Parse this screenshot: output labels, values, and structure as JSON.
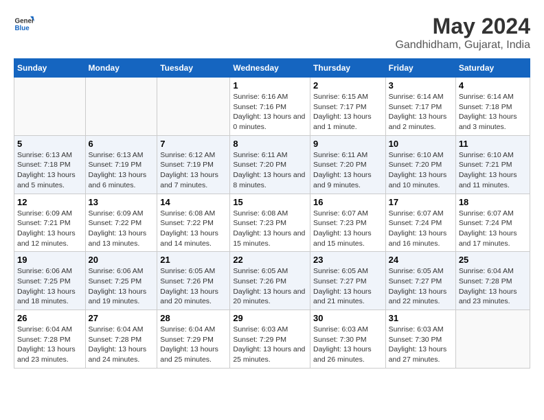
{
  "logo": {
    "line1": "General",
    "line2": "Blue"
  },
  "title": "May 2024",
  "subtitle": "Gandhidham, Gujarat, India",
  "weekdays": [
    "Sunday",
    "Monday",
    "Tuesday",
    "Wednesday",
    "Thursday",
    "Friday",
    "Saturday"
  ],
  "weeks": [
    [
      {
        "day": "",
        "sunrise": "",
        "sunset": "",
        "daylight": ""
      },
      {
        "day": "",
        "sunrise": "",
        "sunset": "",
        "daylight": ""
      },
      {
        "day": "",
        "sunrise": "",
        "sunset": "",
        "daylight": ""
      },
      {
        "day": "1",
        "sunrise": "Sunrise: 6:16 AM",
        "sunset": "Sunset: 7:16 PM",
        "daylight": "Daylight: 13 hours and 0 minutes."
      },
      {
        "day": "2",
        "sunrise": "Sunrise: 6:15 AM",
        "sunset": "Sunset: 7:17 PM",
        "daylight": "Daylight: 13 hours and 1 minute."
      },
      {
        "day": "3",
        "sunrise": "Sunrise: 6:14 AM",
        "sunset": "Sunset: 7:17 PM",
        "daylight": "Daylight: 13 hours and 2 minutes."
      },
      {
        "day": "4",
        "sunrise": "Sunrise: 6:14 AM",
        "sunset": "Sunset: 7:18 PM",
        "daylight": "Daylight: 13 hours and 3 minutes."
      }
    ],
    [
      {
        "day": "5",
        "sunrise": "Sunrise: 6:13 AM",
        "sunset": "Sunset: 7:18 PM",
        "daylight": "Daylight: 13 hours and 5 minutes."
      },
      {
        "day": "6",
        "sunrise": "Sunrise: 6:13 AM",
        "sunset": "Sunset: 7:19 PM",
        "daylight": "Daylight: 13 hours and 6 minutes."
      },
      {
        "day": "7",
        "sunrise": "Sunrise: 6:12 AM",
        "sunset": "Sunset: 7:19 PM",
        "daylight": "Daylight: 13 hours and 7 minutes."
      },
      {
        "day": "8",
        "sunrise": "Sunrise: 6:11 AM",
        "sunset": "Sunset: 7:20 PM",
        "daylight": "Daylight: 13 hours and 8 minutes."
      },
      {
        "day": "9",
        "sunrise": "Sunrise: 6:11 AM",
        "sunset": "Sunset: 7:20 PM",
        "daylight": "Daylight: 13 hours and 9 minutes."
      },
      {
        "day": "10",
        "sunrise": "Sunrise: 6:10 AM",
        "sunset": "Sunset: 7:20 PM",
        "daylight": "Daylight: 13 hours and 10 minutes."
      },
      {
        "day": "11",
        "sunrise": "Sunrise: 6:10 AM",
        "sunset": "Sunset: 7:21 PM",
        "daylight": "Daylight: 13 hours and 11 minutes."
      }
    ],
    [
      {
        "day": "12",
        "sunrise": "Sunrise: 6:09 AM",
        "sunset": "Sunset: 7:21 PM",
        "daylight": "Daylight: 13 hours and 12 minutes."
      },
      {
        "day": "13",
        "sunrise": "Sunrise: 6:09 AM",
        "sunset": "Sunset: 7:22 PM",
        "daylight": "Daylight: 13 hours and 13 minutes."
      },
      {
        "day": "14",
        "sunrise": "Sunrise: 6:08 AM",
        "sunset": "Sunset: 7:22 PM",
        "daylight": "Daylight: 13 hours and 14 minutes."
      },
      {
        "day": "15",
        "sunrise": "Sunrise: 6:08 AM",
        "sunset": "Sunset: 7:23 PM",
        "daylight": "Daylight: 13 hours and 15 minutes."
      },
      {
        "day": "16",
        "sunrise": "Sunrise: 6:07 AM",
        "sunset": "Sunset: 7:23 PM",
        "daylight": "Daylight: 13 hours and 15 minutes."
      },
      {
        "day": "17",
        "sunrise": "Sunrise: 6:07 AM",
        "sunset": "Sunset: 7:24 PM",
        "daylight": "Daylight: 13 hours and 16 minutes."
      },
      {
        "day": "18",
        "sunrise": "Sunrise: 6:07 AM",
        "sunset": "Sunset: 7:24 PM",
        "daylight": "Daylight: 13 hours and 17 minutes."
      }
    ],
    [
      {
        "day": "19",
        "sunrise": "Sunrise: 6:06 AM",
        "sunset": "Sunset: 7:25 PM",
        "daylight": "Daylight: 13 hours and 18 minutes."
      },
      {
        "day": "20",
        "sunrise": "Sunrise: 6:06 AM",
        "sunset": "Sunset: 7:25 PM",
        "daylight": "Daylight: 13 hours and 19 minutes."
      },
      {
        "day": "21",
        "sunrise": "Sunrise: 6:05 AM",
        "sunset": "Sunset: 7:26 PM",
        "daylight": "Daylight: 13 hours and 20 minutes."
      },
      {
        "day": "22",
        "sunrise": "Sunrise: 6:05 AM",
        "sunset": "Sunset: 7:26 PM",
        "daylight": "Daylight: 13 hours and 20 minutes."
      },
      {
        "day": "23",
        "sunrise": "Sunrise: 6:05 AM",
        "sunset": "Sunset: 7:27 PM",
        "daylight": "Daylight: 13 hours and 21 minutes."
      },
      {
        "day": "24",
        "sunrise": "Sunrise: 6:05 AM",
        "sunset": "Sunset: 7:27 PM",
        "daylight": "Daylight: 13 hours and 22 minutes."
      },
      {
        "day": "25",
        "sunrise": "Sunrise: 6:04 AM",
        "sunset": "Sunset: 7:28 PM",
        "daylight": "Daylight: 13 hours and 23 minutes."
      }
    ],
    [
      {
        "day": "26",
        "sunrise": "Sunrise: 6:04 AM",
        "sunset": "Sunset: 7:28 PM",
        "daylight": "Daylight: 13 hours and 23 minutes."
      },
      {
        "day": "27",
        "sunrise": "Sunrise: 6:04 AM",
        "sunset": "Sunset: 7:28 PM",
        "daylight": "Daylight: 13 hours and 24 minutes."
      },
      {
        "day": "28",
        "sunrise": "Sunrise: 6:04 AM",
        "sunset": "Sunset: 7:29 PM",
        "daylight": "Daylight: 13 hours and 25 minutes."
      },
      {
        "day": "29",
        "sunrise": "Sunrise: 6:03 AM",
        "sunset": "Sunset: 7:29 PM",
        "daylight": "Daylight: 13 hours and 25 minutes."
      },
      {
        "day": "30",
        "sunrise": "Sunrise: 6:03 AM",
        "sunset": "Sunset: 7:30 PM",
        "daylight": "Daylight: 13 hours and 26 minutes."
      },
      {
        "day": "31",
        "sunrise": "Sunrise: 6:03 AM",
        "sunset": "Sunset: 7:30 PM",
        "daylight": "Daylight: 13 hours and 27 minutes."
      },
      {
        "day": "",
        "sunrise": "",
        "sunset": "",
        "daylight": ""
      }
    ]
  ]
}
